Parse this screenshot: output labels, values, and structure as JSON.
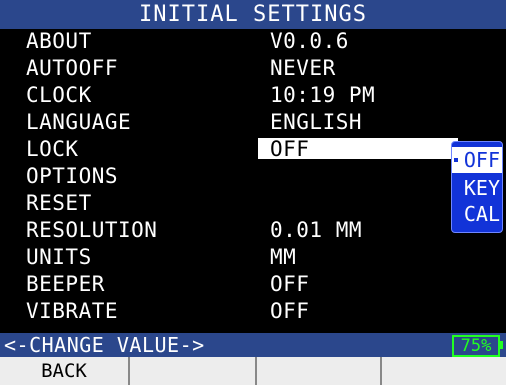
{
  "title": "INITIAL SETTINGS",
  "settings": [
    {
      "label": "ABOUT",
      "value": "V0.0.6"
    },
    {
      "label": "AUTOOFF",
      "value": "NEVER"
    },
    {
      "label": "CLOCK",
      "value": "10:19 PM"
    },
    {
      "label": "LANGUAGE",
      "value": "ENGLISH"
    },
    {
      "label": "LOCK",
      "value": "OFF",
      "selected": true
    },
    {
      "label": "OPTIONS",
      "value": ""
    },
    {
      "label": "RESET",
      "value": ""
    },
    {
      "label": "RESOLUTION",
      "value": "0.01 MM"
    },
    {
      "label": "UNITS",
      "value": "MM"
    },
    {
      "label": "BEEPER",
      "value": "OFF"
    },
    {
      "label": "VIBRATE",
      "value": "OFF"
    }
  ],
  "popup": {
    "options": [
      "OFF",
      "KEY",
      "CAL"
    ],
    "active_index": 0
  },
  "status": {
    "hint": "<-CHANGE VALUE->",
    "battery": "75%"
  },
  "softkeys": [
    "BACK",
    "",
    "",
    ""
  ],
  "colors": {
    "header_bg": "#2b478c",
    "popup_bg": "#1233d8",
    "battery": "#22ff22",
    "softkey_bg": "#ededed"
  }
}
